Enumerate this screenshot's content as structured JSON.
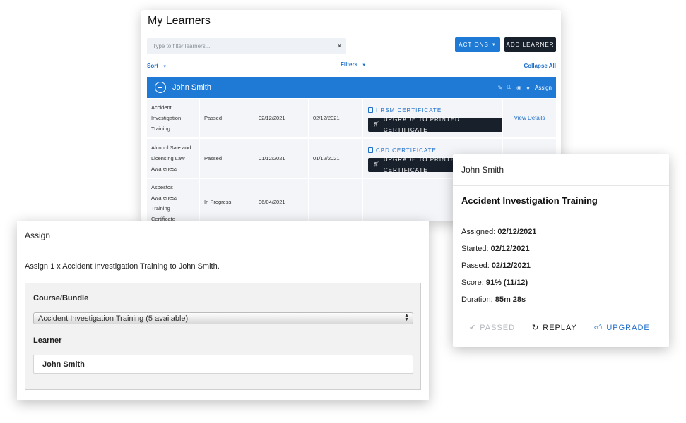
{
  "learners": {
    "title": "My Learners",
    "filter_placeholder": "Type to filter learners...",
    "clear_icon": "×",
    "actions_label": "ACTIONS",
    "add_learner_label": "ADD LEARNER",
    "sort_label": "Sort",
    "filters_label": "Filters",
    "collapse_label": "Collapse All",
    "learner": {
      "name": "John Smith",
      "assign_label": "Assign"
    },
    "rows": [
      {
        "course_lines": [
          "Accident",
          "Investigation",
          "Training"
        ],
        "status": "Passed",
        "date1": "02/12/2021",
        "date2": "02/12/2021",
        "cert": "IIRSM CERTIFICATE",
        "upgrade": "UPGRADE TO PRINTED CERTIFICATE",
        "view": "View Details"
      },
      {
        "course_lines": [
          "Alcohol Sale and",
          "Licensing Law",
          "Awareness"
        ],
        "status": "Passed",
        "date1": "01/12/2021",
        "date2": "01/12/2021",
        "cert": "CPD CERTIFICATE",
        "upgrade": "UPGRADE TO PRINTED CERTIFICATE",
        "view": ""
      },
      {
        "course_lines": [
          "Asbestos",
          "Awareness",
          "Training",
          "Certificate"
        ],
        "status": "In Progress",
        "date1": "06/04/2021",
        "date2": "",
        "cert": "",
        "upgrade": "",
        "view": ""
      }
    ]
  },
  "assign": {
    "title": "Assign",
    "line_prefix": "Assign 1 x Accident Investigation Training to",
    "line_name": "John Smith.",
    "course_label": "Course/Bundle",
    "course_value": "Accident Investigation Training (5 available)",
    "learner_label": "Learner",
    "learner_value": "John Smith"
  },
  "details": {
    "header": "John Smith",
    "title": "Accident Investigation Training",
    "assigned_label": "Assigned:",
    "assigned_value": "02/12/2021",
    "started_label": "Started:",
    "started_value": "02/12/2021",
    "passed_label": "Passed:",
    "passed_value": "02/12/2021",
    "score_label": "Score:",
    "score_value": "91% (11/12)",
    "duration_label": "Duration:",
    "duration_value": "85m 28s",
    "passed_action": "PASSED",
    "replay_action": "REPLAY",
    "upgrade_action": "UPGRADE"
  },
  "colors": {
    "primary_blue": "#1f7ad6",
    "dark_button": "#18202c",
    "link_blue": "#1f6fc9"
  }
}
